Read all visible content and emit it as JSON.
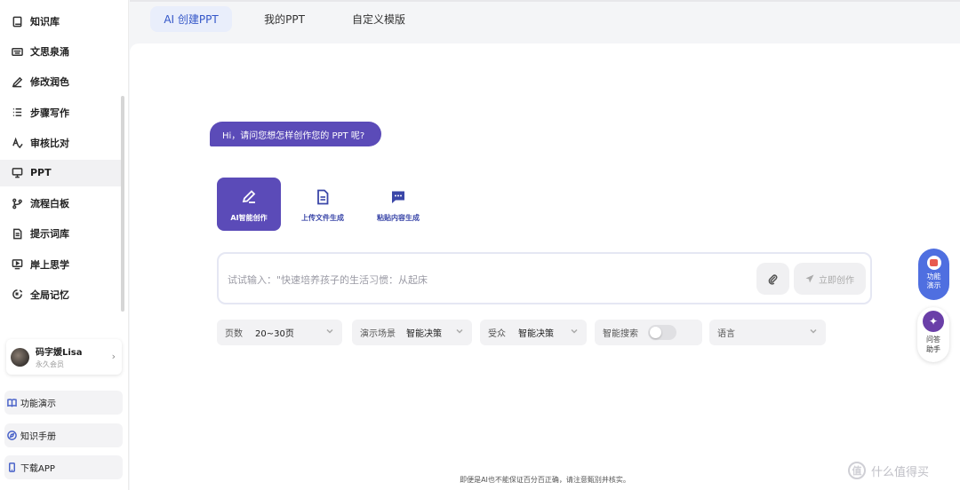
{
  "sidebar": {
    "items": [
      {
        "label": "知识库",
        "icon": "book-icon"
      },
      {
        "label": "文思泉涌",
        "icon": "keyboard-icon"
      },
      {
        "label": "修改润色",
        "icon": "pen-icon"
      },
      {
        "label": "步骤写作",
        "icon": "list-icon"
      },
      {
        "label": "审核比对",
        "icon": "check-text-icon"
      },
      {
        "label": "PPT",
        "icon": "presentation-icon",
        "active": true
      },
      {
        "label": "流程白板",
        "icon": "flow-icon"
      },
      {
        "label": "提示词库",
        "icon": "document-icon"
      },
      {
        "label": "岸上思学",
        "icon": "video-icon"
      },
      {
        "label": "全局记忆",
        "icon": "memory-icon"
      }
    ],
    "user": {
      "name": "码字媛Lisa",
      "membership": "永久会员"
    },
    "bottom": {
      "demo": "功能演示",
      "manual": "知识手册",
      "download": "下载APP"
    }
  },
  "tabs": {
    "ai_create": "AI 创建PPT",
    "my_ppt": "我的PPT",
    "custom_template": "自定义模版"
  },
  "main": {
    "greeting": "Hi，请问您想怎样创作您的 PPT 呢?",
    "modes": {
      "ai": "AI智能创作",
      "upload": "上传文件生成",
      "paste": "粘贴内容生成"
    },
    "input_placeholder": "试试输入：\"快速培养孩子的生活习惯：从起床",
    "create_button": "立即创作",
    "options": {
      "pages_label": "页数",
      "pages_value": "20~30页",
      "scene_label": "演示场景",
      "scene_value": "智能决策",
      "audience_label": "受众",
      "audience_value": "智能决策",
      "search_label": "智能搜索",
      "search_on": false,
      "language_label": "语言"
    },
    "disclaimer": "即便是AI也不能保证百分百正确，请注意甄别并核实。"
  },
  "floating": {
    "demo_line1": "功能",
    "demo_line2": "演示",
    "help_line1": "问答",
    "help_line2": "助手"
  },
  "watermark": {
    "text": "什么值得买",
    "logo": "值"
  },
  "colors": {
    "accent": "#5b4bb8",
    "tab_active_bg": "#e9eefb",
    "tab_active_text": "#3356c8",
    "float_blue": "#4f6fe0"
  }
}
